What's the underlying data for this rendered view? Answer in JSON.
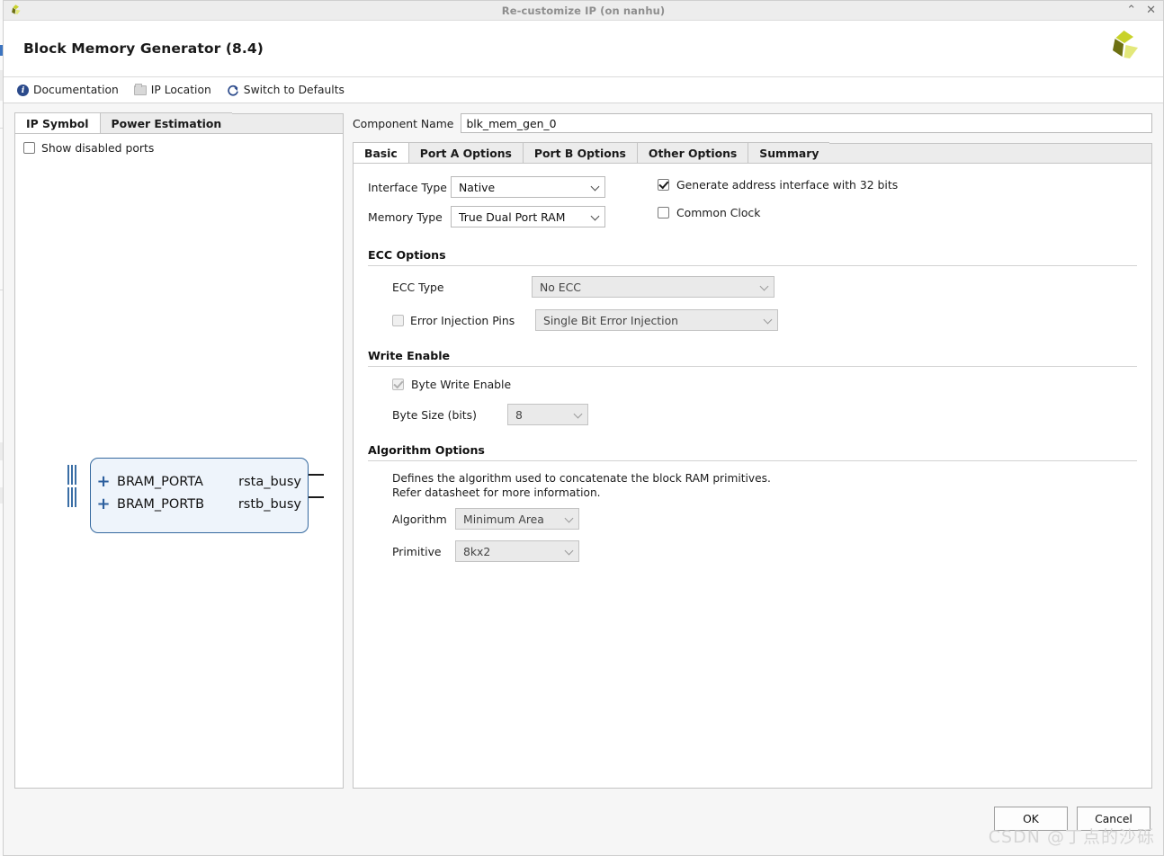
{
  "window": {
    "title": "Re-customize IP (on nanhu)",
    "minimize_glyph": "⌃",
    "close_glyph": "✕",
    "logo_name": "xilinx-logo"
  },
  "header": {
    "title": "Block Memory Generator (8.4)"
  },
  "toolbar": {
    "items": [
      {
        "label": "Documentation",
        "icon": "info-icon"
      },
      {
        "label": "IP Location",
        "icon": "folder-icon"
      },
      {
        "label": "Switch to Defaults",
        "icon": "refresh-icon"
      }
    ]
  },
  "left_panel": {
    "tabs": [
      {
        "label": "IP Symbol",
        "active": true
      },
      {
        "label": "Power Estimation",
        "active": false
      }
    ],
    "show_disabled_ports": {
      "label": "Show disabled ports",
      "checked": false
    },
    "symbol": {
      "ports": [
        {
          "name": "BRAM_PORTA",
          "out": "rsta_busy",
          "expander": "+"
        },
        {
          "name": "BRAM_PORTB",
          "out": "rstb_busy",
          "expander": "+"
        }
      ]
    }
  },
  "right_panel": {
    "component_name": {
      "label": "Component Name",
      "value": "blk_mem_gen_0",
      "placeholder": "blk_mem_gen_0"
    },
    "tabs": [
      {
        "label": "Basic",
        "active": true
      },
      {
        "label": "Port A Options",
        "active": false
      },
      {
        "label": "Port B Options",
        "active": false
      },
      {
        "label": "Other Options",
        "active": false
      },
      {
        "label": "Summary",
        "active": false
      }
    ],
    "basic": {
      "interface_type": {
        "label": "Interface Type",
        "value": "Native"
      },
      "memory_type": {
        "label": "Memory Type",
        "value": "True Dual Port RAM"
      },
      "generate_address_interface": {
        "label": "Generate address interface with 32 bits",
        "checked": true
      },
      "common_clock": {
        "label": "Common Clock",
        "checked": false
      },
      "ecc": {
        "title": "ECC Options",
        "ecc_type": {
          "label": "ECC Type",
          "value": "No ECC",
          "disabled": true
        },
        "error_injection_pins": {
          "label": "Error Injection Pins",
          "checked": false,
          "disabled": true
        },
        "error_injection_value": {
          "value": "Single Bit Error Injection",
          "disabled": true
        }
      },
      "write_enable": {
        "title": "Write Enable",
        "byte_write_enable": {
          "label": "Byte Write Enable",
          "checked": true,
          "disabled": true
        },
        "byte_size": {
          "label": "Byte Size (bits)",
          "value": "8",
          "disabled": true
        }
      },
      "algorithm": {
        "title": "Algorithm Options",
        "description_line1": "Defines the algorithm used to concatenate the block RAM primitives.",
        "description_line2": "Refer datasheet for more information.",
        "algorithm": {
          "label": "Algorithm",
          "value": "Minimum Area",
          "disabled": true
        },
        "primitive": {
          "label": "Primitive",
          "value": "8kx2",
          "disabled": true
        }
      }
    }
  },
  "footer": {
    "ok_label": "OK",
    "cancel_label": "Cancel",
    "watermark": "CSDN @丁点的沙砾"
  }
}
